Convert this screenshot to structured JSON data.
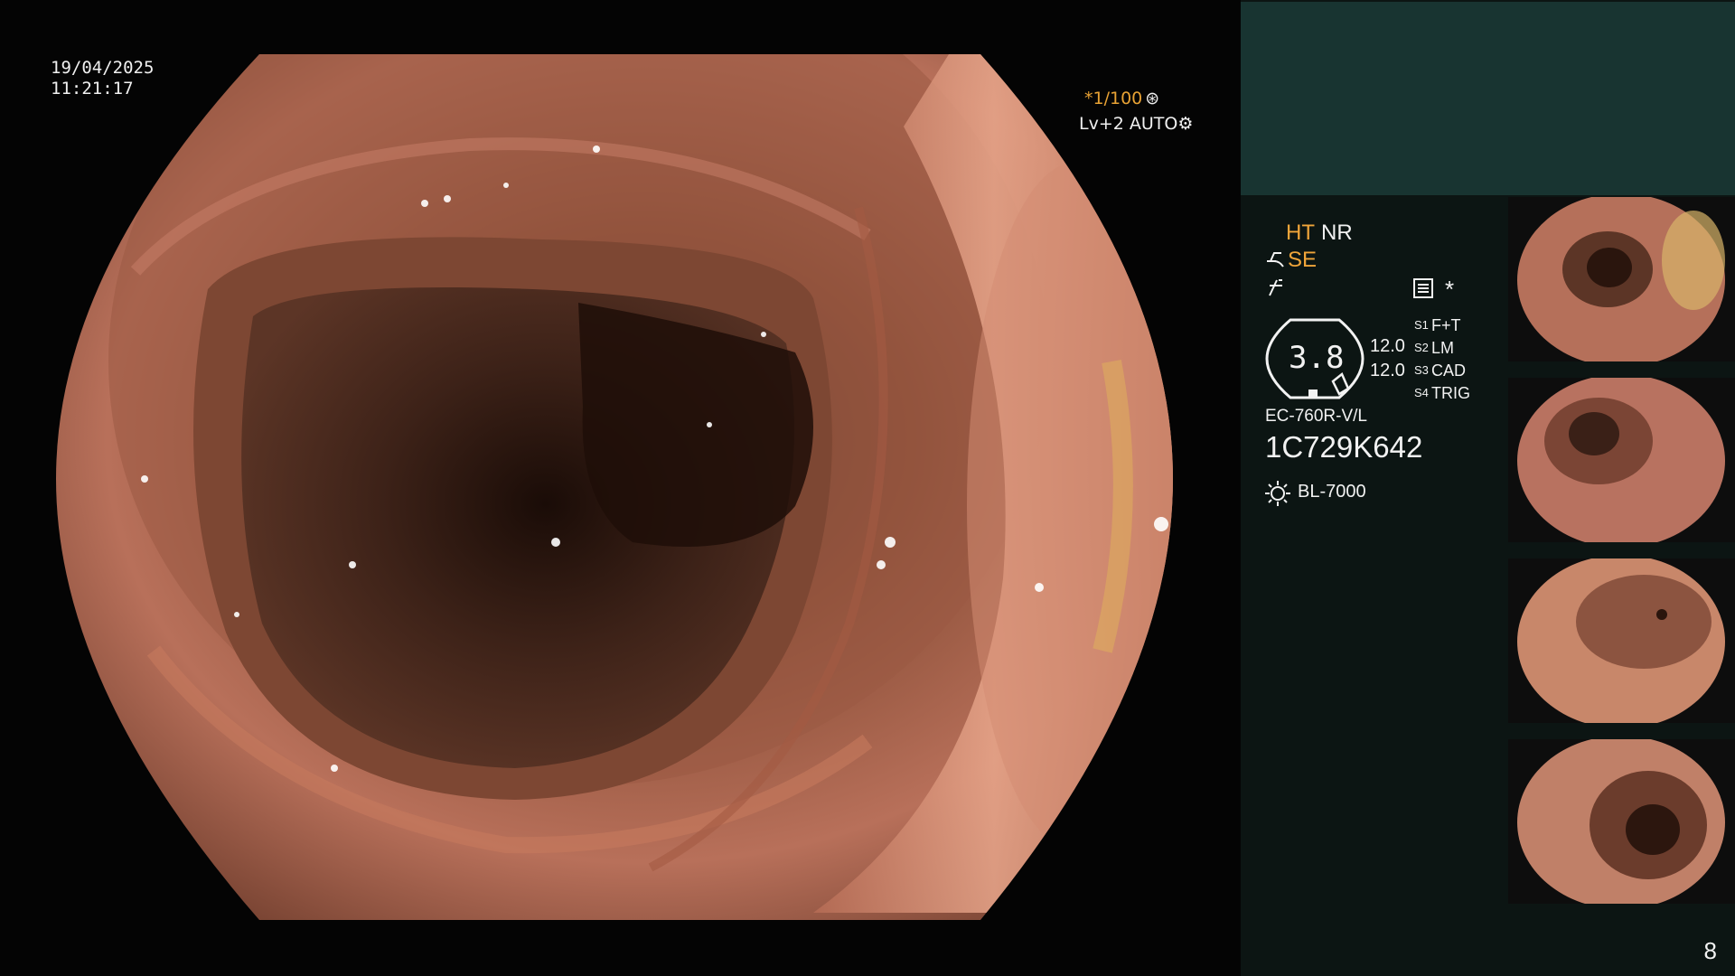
{
  "overlay": {
    "date": "19/04/2025",
    "time": "11:21:17",
    "shutter_prefix": "*",
    "shutter": "1/100",
    "level": "Lv+2 AUTO"
  },
  "panel": {
    "ht": "HT",
    "nr": "NR",
    "se": "SE",
    "dial_value": "3.8",
    "value_1": "12.0",
    "value_2": "12.0",
    "asterisk": "*",
    "s_labels": [
      "S1",
      "S2",
      "S3",
      "S4"
    ],
    "s_values": [
      "F+T",
      "LM",
      "CAD",
      "TRIG"
    ],
    "scope_model": "EC-760R-V/L",
    "serial": "1C729K642",
    "light_source": "BL-7000",
    "page_number": "8"
  },
  "icons": [
    "aperture-icon",
    "gear-icon",
    "scope-bend-icon",
    "freeze-icon",
    "menu-icon",
    "sun-icon"
  ],
  "colors": {
    "panel_bg": "#0c1513",
    "panel_top": "#183431",
    "accent": "#f0a53a"
  }
}
